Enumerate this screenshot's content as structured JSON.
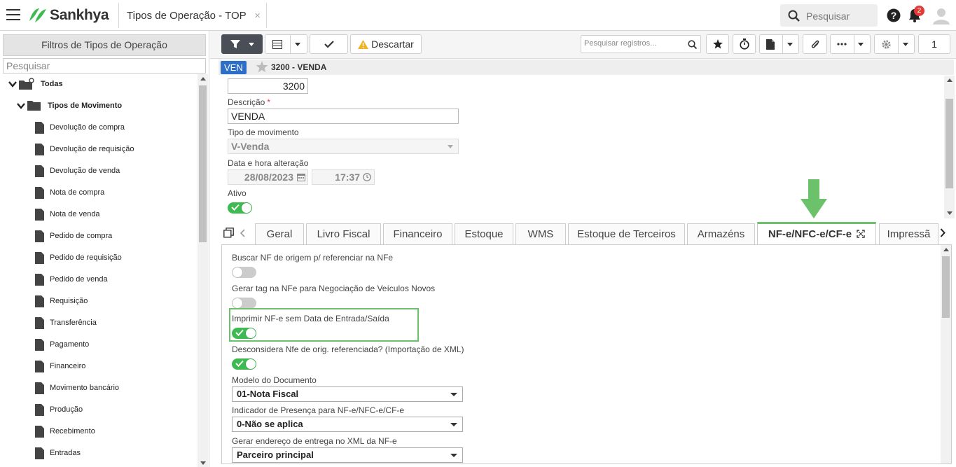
{
  "app": {
    "brand": "Sankhya",
    "tab_title": "Tipos de Operação - TOP",
    "tab_close": "×",
    "global_search_label": "Pesquisar",
    "notification_count": "2"
  },
  "left_panel": {
    "title": "Filtros de Tipos de Operação",
    "search_placeholder": "Pesquisar",
    "tree": {
      "root": "Todas",
      "group": "Tipos de Movimento",
      "items": [
        "Devolução de compra",
        "Devolução de requisição",
        "Devolução de venda",
        "Nota de compra",
        "Nota de venda",
        "Pedido de compra",
        "Pedido de requisição",
        "Pedido de venda",
        "Requisição",
        "Transferência",
        "Pagamento",
        "Financeiro",
        "Movimento bancário",
        "Produção",
        "Recebimento",
        "Entradas"
      ]
    }
  },
  "toolbar": {
    "discard_label": "Descartar",
    "records_search_placeholder": "Pesquisar registros...",
    "page_number": "1",
    "icons": [
      "filter-icon",
      "grid-icon",
      "check-icon",
      "warning-icon",
      "search-icon",
      "star-icon",
      "timer-icon",
      "document-icon",
      "paperclip-icon",
      "more-icon",
      "gear-icon"
    ]
  },
  "record": {
    "badge": "VEN",
    "title": "3200 - VENDA"
  },
  "form": {
    "code_value": "3200",
    "descricao_label": "Descrição",
    "descricao_required": "*",
    "descricao_value": "VENDA",
    "tipo_mov_label": "Tipo de movimento",
    "tipo_mov_value": "V-Venda",
    "data_label": "Data e hora alteração",
    "date_value": "28/08/2023",
    "time_value": "17:37",
    "ativo_label": "Ativo",
    "ativo_on": true
  },
  "tabs": [
    {
      "label": "Geral",
      "active": false
    },
    {
      "label": "Livro Fiscal",
      "active": false
    },
    {
      "label": "Financeiro",
      "active": false
    },
    {
      "label": "Estoque",
      "active": false
    },
    {
      "label": "WMS",
      "active": false
    },
    {
      "label": "Estoque de Terceiros",
      "active": false
    },
    {
      "label": "Armazéns",
      "active": false
    },
    {
      "label": "NF-e/NFC-e/CF-e",
      "active": true
    },
    {
      "label": "Impressã",
      "active": false
    }
  ],
  "nfe_tab": {
    "options": [
      {
        "label": "Buscar NF de origem p/ referenciar na NFe",
        "on": false
      },
      {
        "label": "Gerar tag na NFe para Negociação de Veículos Novos",
        "on": false
      },
      {
        "label": "Imprimir NF-e sem Data de Entrada/Saída",
        "on": true
      },
      {
        "label": "Desconsidera Nfe de orig. referenciada? (Importação de XML)",
        "on": true
      }
    ],
    "modelo_label": "Modelo do Documento",
    "modelo_value": "01-Nota Fiscal",
    "presenca_label": "Indicador de Presença para NF-e/NFC-e/CF-e",
    "presenca_value": "0-Não se aplica",
    "endereco_label": "Gerar endereço de entrega no XML da NF-e",
    "endereco_value": "Parceiro principal"
  },
  "colors": {
    "brand_green": "#3dbb50",
    "accent_blue": "#2d6fc7",
    "highlight_green": "#6cc26a",
    "badge_red": "#e53935"
  }
}
